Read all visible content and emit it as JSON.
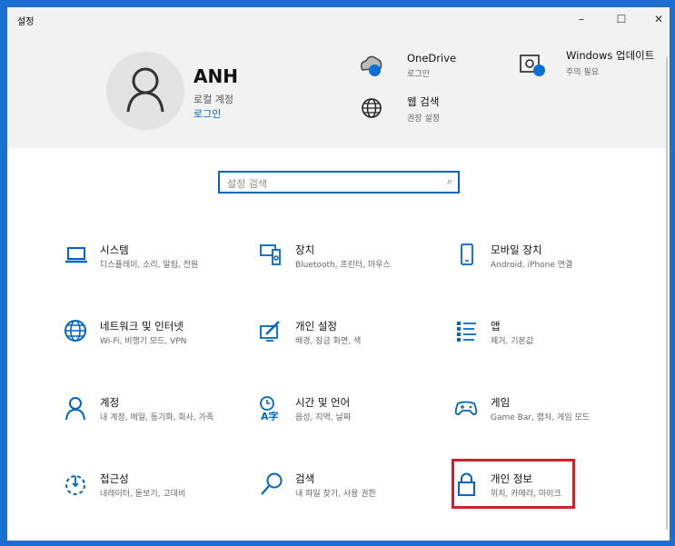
{
  "window": {
    "title": "설정",
    "minimize": "–",
    "maximize": "☐",
    "close": "✕"
  },
  "user": {
    "name": "ANH",
    "account_type": "로컬 계정",
    "login_link": "로그인"
  },
  "header_items": [
    {
      "title": "OneDrive",
      "subtitle": "로그인",
      "icon": "cloud-icon"
    },
    {
      "title": "Windows 업데이트",
      "subtitle": "주의 필요",
      "icon": "update-icon"
    },
    {
      "title": "웹 검색",
      "subtitle": "권장 설정",
      "icon": "globe-icon"
    }
  ],
  "search": {
    "placeholder": "설정 검색",
    "icon": "⌕"
  },
  "tiles": [
    {
      "title": "시스템",
      "subtitle": "디스플레이, 소리, 알림, 전원",
      "icon": "laptop-icon"
    },
    {
      "title": "장치",
      "subtitle": "Bluetooth, 프린터, 마우스",
      "icon": "devices-icon"
    },
    {
      "title": "모바일 장치",
      "subtitle": "Android, iPhone 연결",
      "icon": "phone-icon"
    },
    {
      "title": "네트워크 및 인터넷",
      "subtitle": "Wi-Fi, 비행기 모드, VPN",
      "icon": "globe-icon"
    },
    {
      "title": "개인 설정",
      "subtitle": "배경, 잠금 화면, 색",
      "icon": "personalization-icon"
    },
    {
      "title": "앱",
      "subtitle": "제거, 기본값",
      "icon": "apps-list-icon"
    },
    {
      "title": "계정",
      "subtitle": "내 계정, 메일, 동기화, 회사, 가족",
      "icon": "person-icon"
    },
    {
      "title": "시간 및 언어",
      "subtitle": "음성, 지역, 날짜",
      "icon": "time-language-icon"
    },
    {
      "title": "게임",
      "subtitle": "Game Bar, 캡처, 게임 모드",
      "icon": "gamepad-icon"
    },
    {
      "title": "접근성",
      "subtitle": "내레이터, 돋보기, 고대비",
      "icon": "accessibility-icon"
    },
    {
      "title": "검색",
      "subtitle": "내 파일 찾기, 사용 권한",
      "icon": "search-icon"
    },
    {
      "title": "개인 정보",
      "subtitle": "위치, 카메라, 마이크",
      "icon": "lock-icon"
    }
  ],
  "colors": {
    "accent": "#0067c0",
    "highlight": "#d0202a"
  }
}
